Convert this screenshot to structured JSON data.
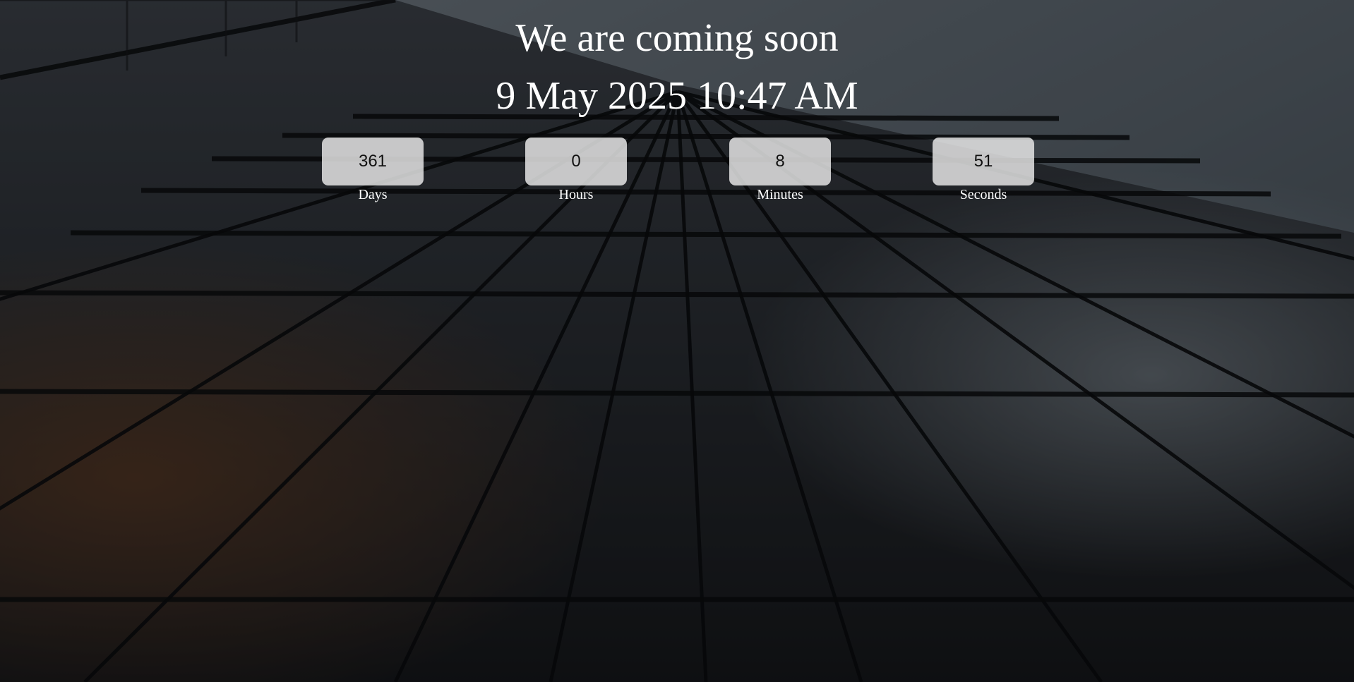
{
  "page": {
    "headline": "We are coming soon",
    "launch_date": "9 May 2025 10:47 AM"
  },
  "countdown": {
    "days": {
      "value": "361",
      "label": "Days"
    },
    "hours": {
      "value": "0",
      "label": "Hours"
    },
    "minutes": {
      "value": "8",
      "label": "Minutes"
    },
    "seconds": {
      "value": "51",
      "label": "Seconds"
    }
  },
  "background": {
    "subject": "glass-skyscraper-facade-looking-up",
    "overlay_color": "#000000",
    "sky_color": "#8f9ba6"
  }
}
